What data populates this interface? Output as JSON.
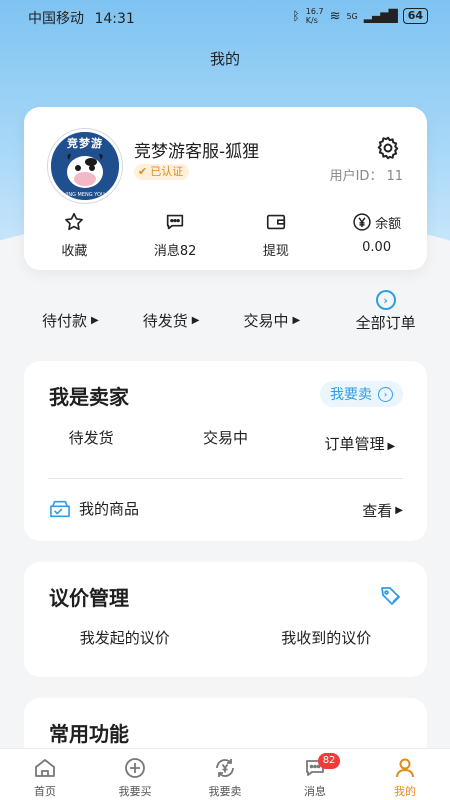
{
  "status": {
    "carrier": "中国移动",
    "time": "14:31",
    "speed_top": "16.7",
    "speed_unit": "K/s",
    "network": "5G",
    "battery": "64"
  },
  "page_title": "我的",
  "profile": {
    "avatar_text": "竞梦游",
    "avatar_subtext": "JING MENG YOU",
    "username": "竞梦游客服-狐狸",
    "verified_label": "已认证",
    "uid_label": "用户ID：",
    "uid_value": "11"
  },
  "stats": [
    {
      "icon": "star-icon",
      "label": "收藏"
    },
    {
      "icon": "message-icon",
      "label": "消息82"
    },
    {
      "icon": "wallet-icon",
      "label": "提现"
    },
    {
      "icon": "yen-icon",
      "icon_label": "余额",
      "label": "0.00"
    }
  ],
  "orders": {
    "pending_payment": "待付款",
    "pending_shipment": "待发货",
    "in_trade": "交易中",
    "all": "全部订单"
  },
  "seller": {
    "title": "我是卖家",
    "sell_button": "我要卖",
    "pending_shipment": "待发货",
    "in_trade": "交易中",
    "order_manage": "订单管理",
    "my_goods": "我的商品",
    "view": "查看"
  },
  "bargain": {
    "title": "议价管理",
    "initiated": "我发起的议价",
    "received": "我收到的议价"
  },
  "common": {
    "title": "常用功能"
  },
  "tabbar": [
    {
      "icon": "home-icon",
      "label": "首页"
    },
    {
      "icon": "buy-icon",
      "label": "我要买"
    },
    {
      "icon": "sell-icon",
      "label": "我要卖"
    },
    {
      "icon": "message-icon",
      "label": "消息",
      "badge": "82"
    },
    {
      "icon": "person-icon",
      "label": "我的",
      "active": true
    }
  ],
  "colors": {
    "accent": "#2f9ee8",
    "active_tab": "#e28a1b",
    "badge": "#f23a3a"
  }
}
